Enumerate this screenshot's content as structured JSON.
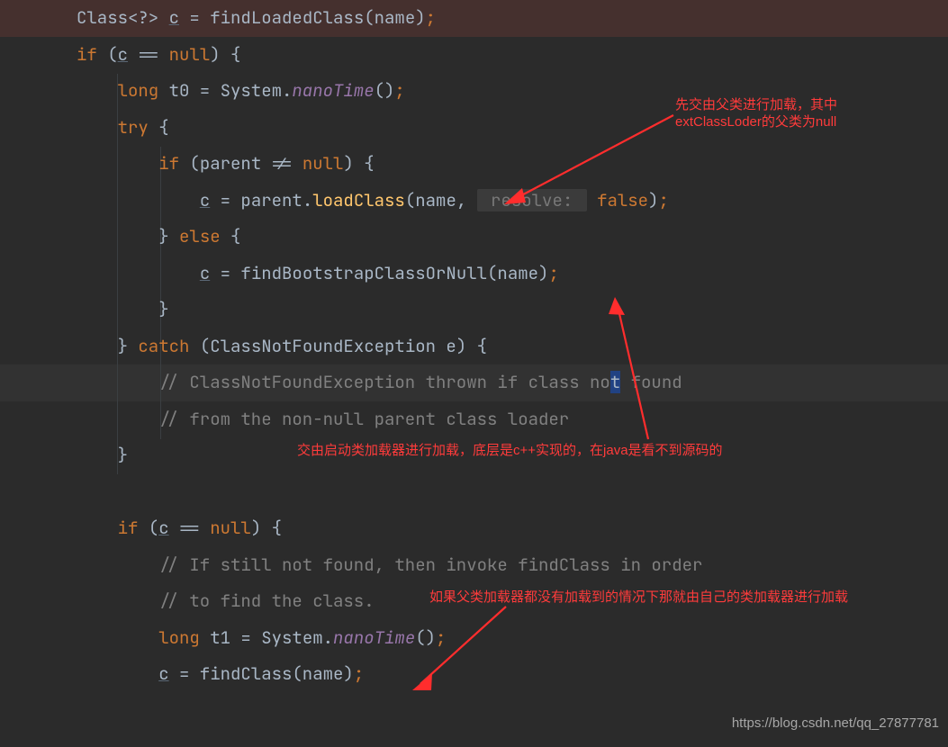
{
  "code": {
    "l1": "Class<?> ",
    "l1_c": "c",
    "l1_rest1": " = findLoadedClass(name)",
    "l1_semi": ";",
    "l2_if": "if",
    "l2_rest1": " (",
    "l2_c": "c",
    "l2_rest2": " == ",
    "l2_null": "null",
    "l2_rest3": ") {",
    "l3_long": "    long",
    "l3_rest1": " t0 = System.",
    "l3_nano": "nanoTime",
    "l3_rest2": "()",
    "l3_semi": ";",
    "l4_try": "    try",
    "l4_rest": " {",
    "l5_if": "        if",
    "l5_rest1": " (parent != ",
    "l5_null": "null",
    "l5_rest2": ") {",
    "l6_pad": "            ",
    "l6_c": "c",
    "l6_rest1": " = parent.",
    "l6_load": "loadClass",
    "l6_rest2": "(name, ",
    "l6_hint": " resolve: ",
    "l6_false": "false",
    "l6_rest3": ")",
    "l6_semi": ";",
    "l7": "        } ",
    "l7_else": "else",
    "l7_rest": " {",
    "l8_pad": "            ",
    "l8_c": "c",
    "l8_rest1": " = ",
    "l8_find": "findBootstrapClassOrNull",
    "l8_rest2": "(name)",
    "l8_semi": ";",
    "l9": "        }",
    "l10_close": "    } ",
    "l10_catch": "catch",
    "l10_rest": " (ClassNotFoundException e) {",
    "l11_cmt": "        // ClassNotFoundException thrown if class no",
    "l11_caret": "t",
    "l11_cmt2": " found",
    "l12_cmt": "        // from the non-null parent class loader",
    "l13": "    }",
    "l14": "",
    "l15_if": "    if",
    "l15_rest1": " (",
    "l15_c": "c",
    "l15_rest2": " == ",
    "l15_null": "null",
    "l15_rest3": ") {",
    "l16_cmt": "        // If still not found, then invoke findClass in order",
    "l17_cmt": "        // to find the class.",
    "l18_long": "        long",
    "l18_rest1": " t1 = System.",
    "l18_nano": "nanoTime",
    "l18_rest2": "()",
    "l18_semi": ";",
    "l19_pad": "        ",
    "l19_c": "c",
    "l19_rest1": " = findClass(name)",
    "l19_semi": ";"
  },
  "annotations": {
    "a1_line1": "先交由父类进行加载，其中",
    "a1_line2": "extClassLoder的父类为null",
    "a2": "交由启动类加载器进行加载，底层是c++实现的，在java是看不到源码的",
    "a3": "如果父类加载器都没有加载到的情况下那就由自己的类加载器进行加载"
  },
  "watermark": "https://blog.csdn.net/qq_27877781"
}
